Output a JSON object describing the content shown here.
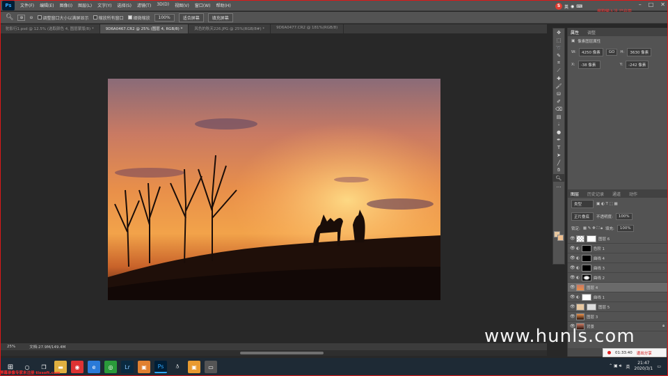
{
  "app": {
    "logo": "Ps"
  },
  "menu": [
    "文件(F)",
    "编辑(E)",
    "图像(I)",
    "图层(L)",
    "文字(Y)",
    "选择(S)",
    "滤镜(T)",
    "3D(D)",
    "视图(V)",
    "窗口(W)",
    "帮助(H)"
  ],
  "ime": {
    "badge": "S",
    "lang": "英",
    "overlay": "搜狗输入法 已启用"
  },
  "options": {
    "resize_windows": "调整窗口大小以满屏显示",
    "zoom_all": "缩放所有窗口",
    "scrubby_zoom": "细微缩放",
    "zoom_value": "100%",
    "fit_screen": "适合屏幕",
    "fill_screen": "填充屏幕"
  },
  "tabs": [
    {
      "label": "驼影行1.psd @ 12.5% (选取颜色 4, 图层蒙版/8) *",
      "active": false
    },
    {
      "label": "9D6A0467.CR2 @ 25% (图层 4, RGB/8) *",
      "active": true
    },
    {
      "label": "风色的秋天226.JPG @ 25%(RGB/8#) *",
      "active": false
    },
    {
      "label": "9D6A0477.CR2 @ 181%(RGB/8)",
      "active": false
    }
  ],
  "status": {
    "zoom": "25%",
    "doc": "文档:27.9M/149.4M"
  },
  "properties": {
    "tabs": [
      "属性",
      "调整"
    ],
    "title": "像素图层属性",
    "w_label": "W:",
    "w_value": "4250 像素",
    "h_label": "H:",
    "h_value": "3630 像素",
    "x_label": "X:",
    "x_value": "-38 像素",
    "y_label": "Y:",
    "y_value": "-242 像素",
    "link": "GO"
  },
  "layers_panel": {
    "tabs": [
      "图层",
      "历史记录",
      "通道",
      "动作"
    ],
    "filter": "类型",
    "blend_mode": "正片叠底",
    "opacity_label": "不透明度:",
    "opacity": "100%",
    "lock_label": "锁定:",
    "fill_label": "填充:",
    "fill": "100%",
    "layers": [
      {
        "name": "图层 6",
        "type": "pixel",
        "selected": false
      },
      {
        "name": "色阶 1",
        "type": "adj",
        "selected": false
      },
      {
        "name": "曲线 4",
        "type": "adj",
        "selected": false
      },
      {
        "name": "曲线 3",
        "type": "adj",
        "selected": false
      },
      {
        "name": "曲线 2",
        "type": "adj",
        "selected": false
      },
      {
        "name": "图层 4",
        "type": "pixel",
        "selected": true
      },
      {
        "name": "曲线 1",
        "type": "adj",
        "selected": false
      },
      {
        "name": "图层 5",
        "type": "pixel",
        "selected": false
      },
      {
        "name": "图层 3",
        "type": "pixel",
        "selected": false
      },
      {
        "name": "背景",
        "type": "pixel",
        "selected": false
      }
    ]
  },
  "recording": {
    "time": "01:33:40",
    "stop": "退出分享"
  },
  "watermark": "www.hunls.com",
  "taskbar": {
    "lang": "英",
    "time": "21:47",
    "date": "2020/3/1"
  },
  "corner_logo": "屏幕录像专家未注册 tlxsoft.com",
  "colors": {
    "accent": "#31a8ff",
    "panel": "#535353",
    "canvas_bg": "#282828"
  }
}
